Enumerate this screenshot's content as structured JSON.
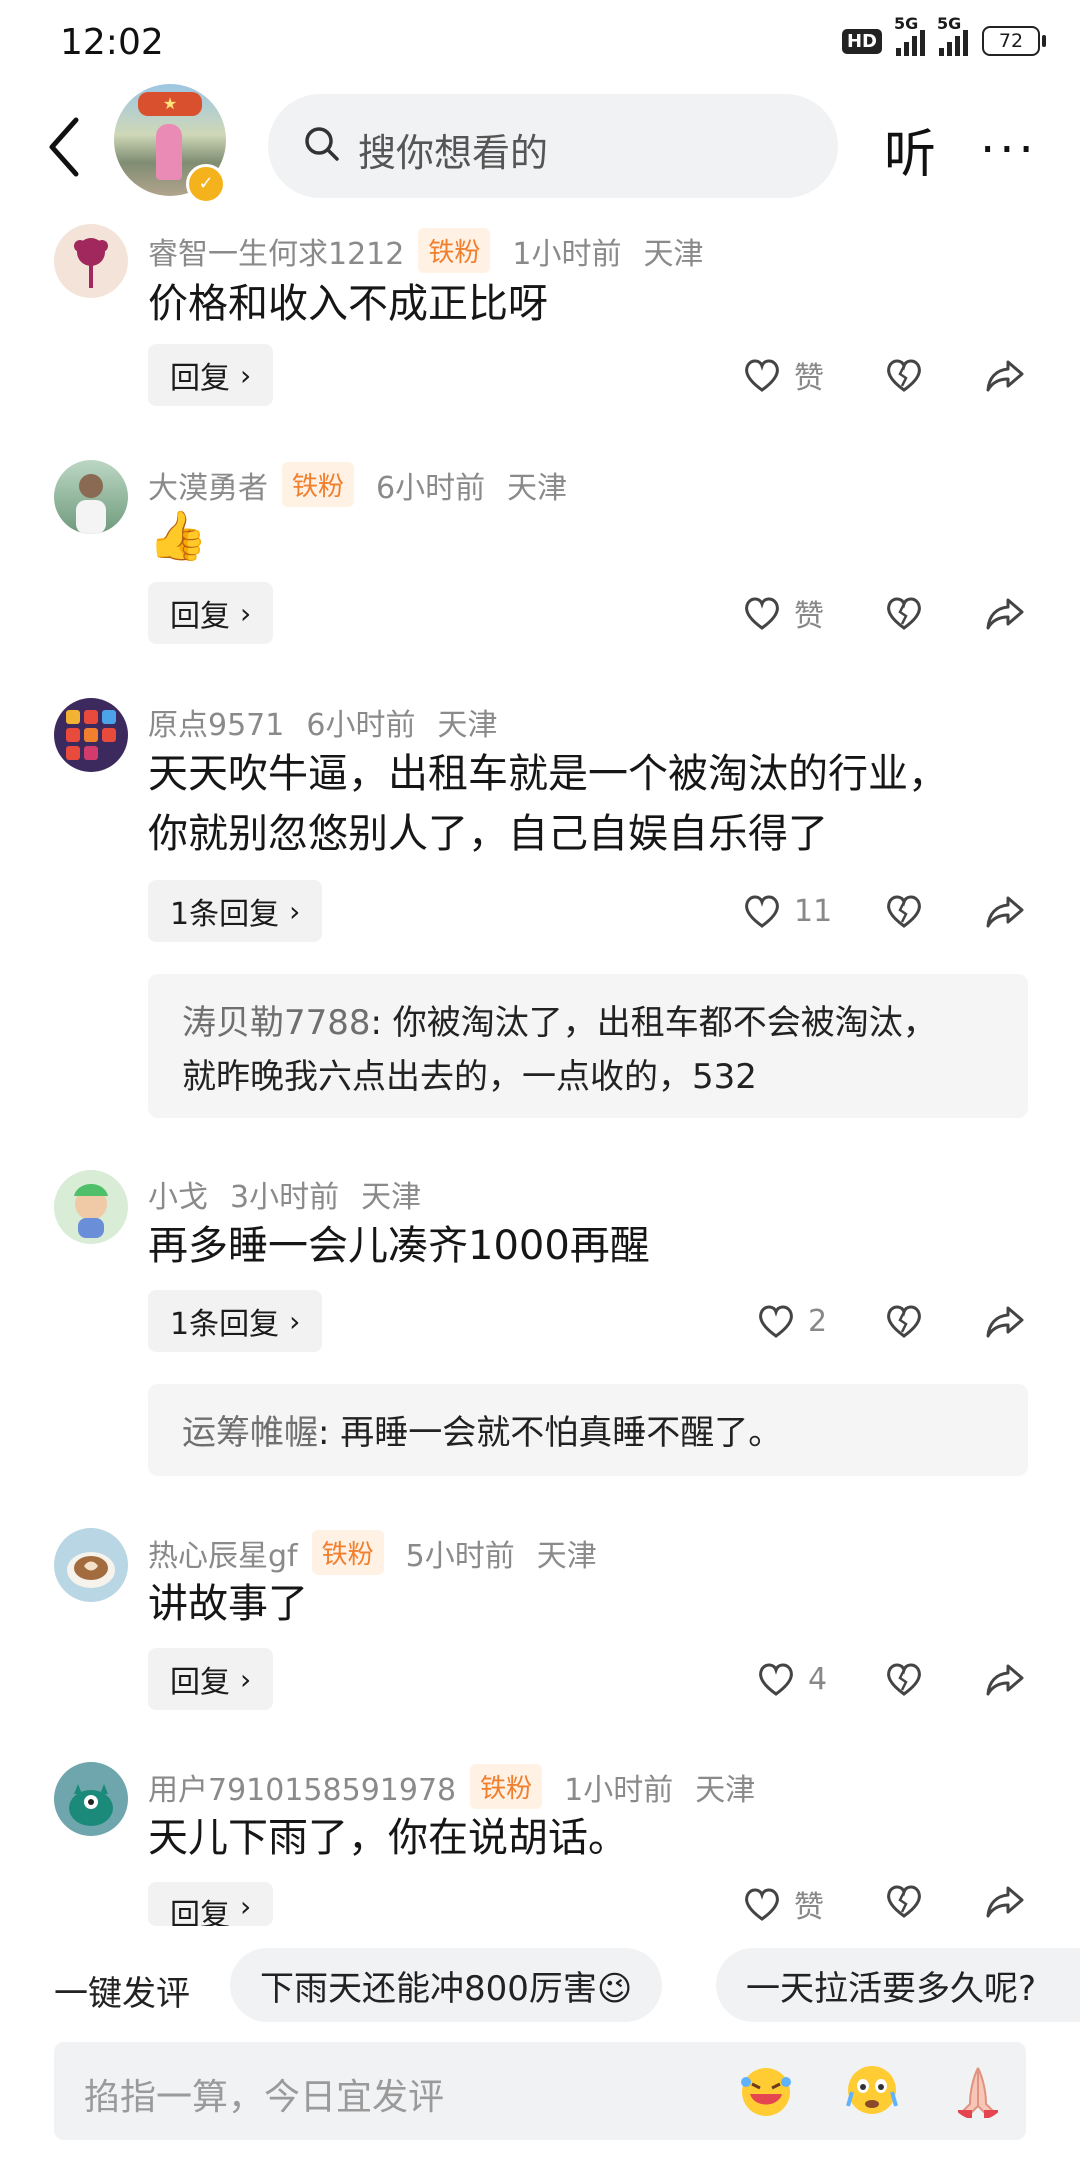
{
  "status_bar": {
    "time": "12:02",
    "hd": "HD",
    "net1": "5G",
    "net2": "5G",
    "battery": "72"
  },
  "header": {
    "search_placeholder": "搜你想看的",
    "listen": "听",
    "more": "···"
  },
  "comments": [
    {
      "user": "睿智一生何求1212",
      "badge": "铁粉",
      "time": "1小时前",
      "location": "天津",
      "text": "价格和收入不成正比呀",
      "reply_label": "回复",
      "like": "赞"
    },
    {
      "user": "大漠勇者",
      "badge": "铁粉",
      "time": "6小时前",
      "location": "天津",
      "text": "👍",
      "reply_label": "回复",
      "like": "赞"
    },
    {
      "user": "原点9571",
      "time": "6小时前",
      "location": "天津",
      "text_line1": "天天吹牛逼，出租车就是一个被淘汰的行业，",
      "text_line2": "你就别忽悠别人了，自己自娱自乐得了",
      "reply_label": "1条回复",
      "like": "11",
      "subreply": {
        "author": "涛贝勒7788",
        "line1": ": 你被淘汰了，出租车都不会被淘汰，",
        "line2": "就昨晚我六点出去的，一点收的，532"
      }
    },
    {
      "user": "小戈",
      "time": "3小时前",
      "location": "天津",
      "text": "再多睡一会儿凑齐1000再醒",
      "reply_label": "1条回复",
      "like": "2",
      "subreply": {
        "author": "运筹帷幄",
        "line1": ": 再睡一会就不怕真睡不醒了。"
      }
    },
    {
      "user": "热心辰星gf",
      "badge": "铁粉",
      "time": "5小时前",
      "location": "天津",
      "text": "讲故事了",
      "reply_label": "回复",
      "like": "4"
    },
    {
      "user": "用户7910158591978",
      "badge": "铁粉",
      "time": "1小时前",
      "location": "天津",
      "text": "天儿下雨了，你在说胡话。",
      "reply_label": "回复",
      "like": "赞"
    }
  ],
  "quick_comment": {
    "label": "一键发评",
    "chips": [
      "下雨天还能冲800厉害😉",
      "一天拉活要多久呢?"
    ]
  },
  "input": {
    "placeholder": "掐指一算，今日宜发评"
  },
  "colors": {
    "badge_text": "#f07f2e",
    "badge_bg": "#fff1e4",
    "verified": "#f4b21c"
  }
}
